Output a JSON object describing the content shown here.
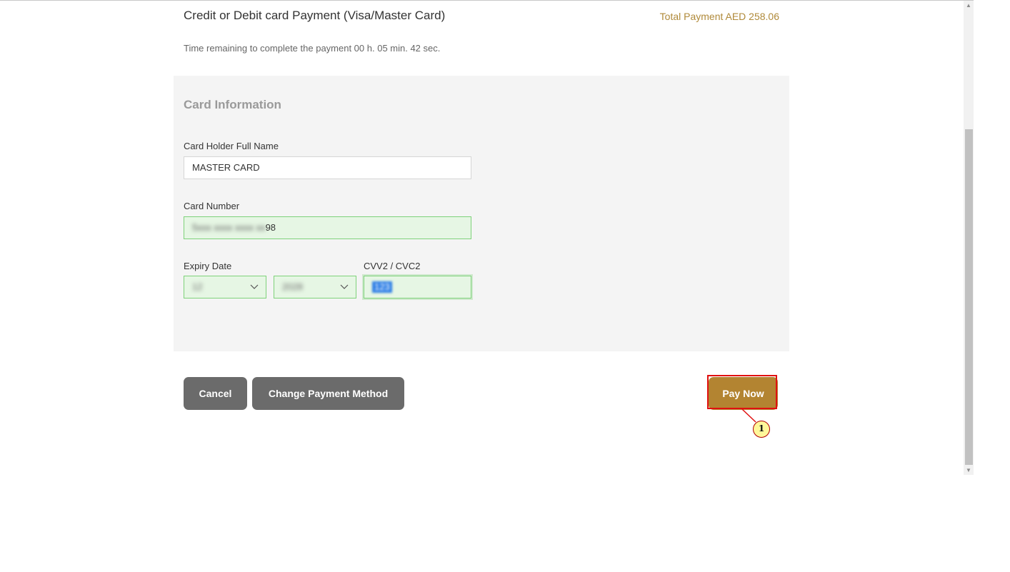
{
  "header": {
    "title": "Credit or Debit card Payment (Visa/Master Card)",
    "total_payment": "Total Payment AED 258.06",
    "time_remaining": "Time remaining to complete the payment 00 h. 05 min. 42 sec."
  },
  "card_information": {
    "section_title": "Card Information",
    "holder_name": {
      "label": "Card Holder Full Name",
      "value": "MASTER CARD"
    },
    "card_number": {
      "label": "Card Number",
      "masked_prefix": "5xxx xxxx xxxx xx",
      "visible_suffix": "98"
    },
    "expiry": {
      "label": "Expiry Date",
      "month_value": "12",
      "year_value": "2028"
    },
    "cvv": {
      "label": "CVV2 / CVC2",
      "value": "123"
    }
  },
  "actions": {
    "cancel_label": "Cancel",
    "change_method_label": "Change Payment Method",
    "pay_now_label": "Pay Now"
  },
  "annotation": {
    "step_number": "1"
  },
  "colors": {
    "accent_gold": "#b38431",
    "total_text": "#b08a3a",
    "valid_field_bg": "#e6f6e4",
    "valid_field_border": "#7ed27a",
    "secondary_button": "#6b6b6b",
    "highlight_red": "#e01010",
    "marker_yellow": "#fff79a"
  },
  "icons": {
    "select_arrow": "chevron-down-icon",
    "scroll_up": "scroll-up-arrow-icon",
    "scroll_down": "scroll-down-arrow-icon"
  }
}
